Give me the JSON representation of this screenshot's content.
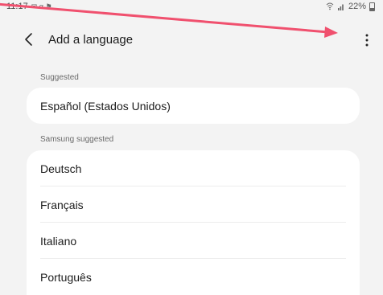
{
  "status_bar": {
    "time": "11:17",
    "notification_icons": "✉ α ⚑",
    "battery_percent": "22%"
  },
  "header": {
    "title": "Add a language"
  },
  "sections": {
    "suggested": {
      "label": "Suggested",
      "items": [
        "Español (Estados Unidos)"
      ]
    },
    "samsung_suggested": {
      "label": "Samsung suggested",
      "items": [
        "Deutsch",
        "Français",
        "Italiano",
        "Português"
      ]
    }
  },
  "annotation": {
    "arrow_color": "#f0506e"
  },
  "colors": {
    "background": "#f3f3f3",
    "card": "#ffffff",
    "section_label": "#6b6b6b"
  }
}
